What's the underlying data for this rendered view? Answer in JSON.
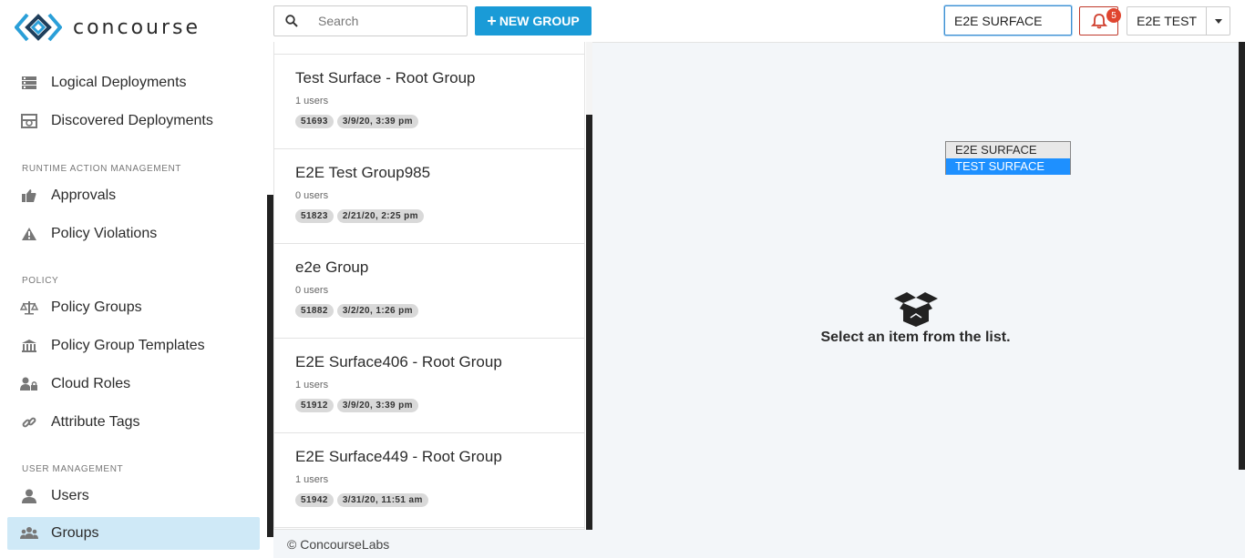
{
  "app": {
    "name": "concourse"
  },
  "sidebar": {
    "items": [
      {
        "label": "Logical Deployments",
        "icon": "server-icon"
      },
      {
        "label": "Discovered Deployments",
        "icon": "deploy-search-icon"
      }
    ],
    "sections": [
      {
        "title": "RUNTIME ACTION MANAGEMENT",
        "items": [
          {
            "label": "Approvals",
            "icon": "thumbs-up-icon"
          },
          {
            "label": "Policy Violations",
            "icon": "warning-icon"
          }
        ]
      },
      {
        "title": "POLICY",
        "items": [
          {
            "label": "Policy Groups",
            "icon": "scale-icon"
          },
          {
            "label": "Policy Group Templates",
            "icon": "bank-icon"
          },
          {
            "label": "Cloud Roles",
            "icon": "user-lock-icon"
          },
          {
            "label": "Attribute Tags",
            "icon": "link-icon"
          }
        ]
      },
      {
        "title": "USER MANAGEMENT",
        "items": [
          {
            "label": "Users",
            "icon": "user-icon"
          },
          {
            "label": "Groups",
            "icon": "users-icon",
            "active": true
          }
        ]
      }
    ]
  },
  "topbar": {
    "search_placeholder": "Search",
    "new_group_label": "NEW GROUP",
    "surface_value": "E2E SURFACE",
    "notification_count": "5",
    "user_name": "E2E TEST"
  },
  "surface_options": [
    "E2E SURFACE",
    "TEST SURFACE"
  ],
  "groups": [
    {
      "name": "Test Surface - Root Group",
      "users": "1 users",
      "id": "51693",
      "date": "3/9/20, 3:39 pm"
    },
    {
      "name": "E2E Test Group985",
      "users": "0 users",
      "id": "51823",
      "date": "2/21/20, 2:25 pm"
    },
    {
      "name": "e2e Group",
      "users": "0 users",
      "id": "51882",
      "date": "3/2/20, 1:26 pm"
    },
    {
      "name": "E2E Surface406 - Root Group",
      "users": "1 users",
      "id": "51912",
      "date": "3/9/20, 3:39 pm"
    },
    {
      "name": "E2E Surface449 - Root Group",
      "users": "1 users",
      "id": "51942",
      "date": "3/31/20, 11:51 am"
    }
  ],
  "detail": {
    "empty_text": "Select an item from the list."
  },
  "footer": {
    "text": "© ConcourseLabs"
  },
  "colors": {
    "accent": "#1a9bd7",
    "active_nav": "#cfe9f7",
    "alert": "#e0452f"
  }
}
